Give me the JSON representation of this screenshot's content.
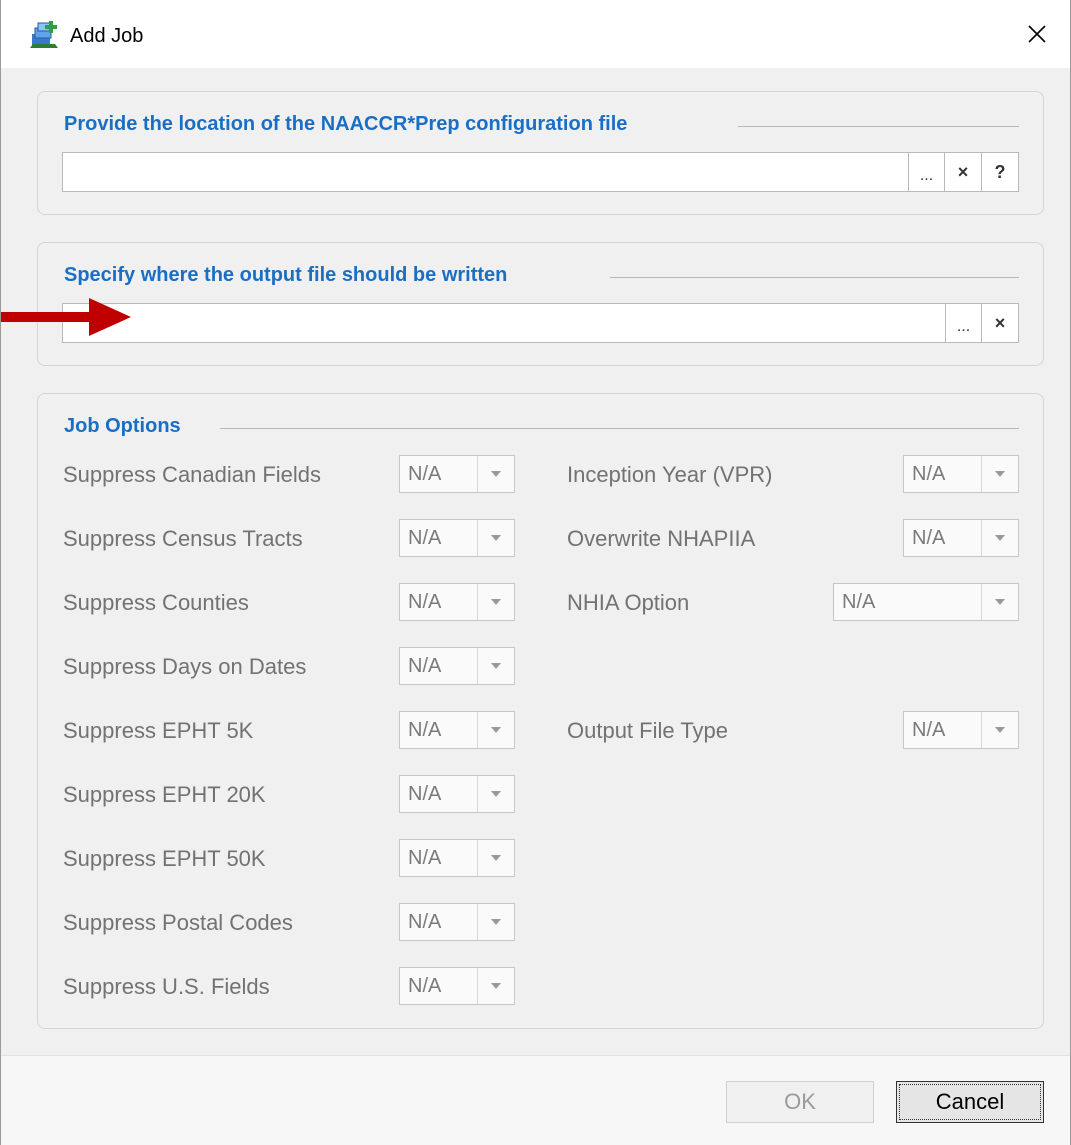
{
  "window": {
    "title": "Add Job"
  },
  "config_group": {
    "title": "Provide the location of the NAACCR*Prep configuration file",
    "path_value": "",
    "browse_label": "...",
    "clear_label": "×",
    "help_label": "?"
  },
  "output_group": {
    "title": "Specify where the output file should be written",
    "path_value": "",
    "browse_label": "...",
    "clear_label": "×"
  },
  "options_group": {
    "title": "Job Options",
    "left": [
      {
        "label": "Suppress Canadian Fields",
        "value": "N/A"
      },
      {
        "label": "Suppress Census Tracts",
        "value": "N/A"
      },
      {
        "label": "Suppress Counties",
        "value": "N/A"
      },
      {
        "label": "Suppress Days on Dates",
        "value": "N/A"
      },
      {
        "label": "Suppress EPHT 5K",
        "value": "N/A"
      },
      {
        "label": "Suppress EPHT 20K",
        "value": "N/A"
      },
      {
        "label": "Suppress EPHT 50K",
        "value": "N/A"
      },
      {
        "label": "Suppress Postal Codes",
        "value": "N/A"
      },
      {
        "label": "Suppress U.S. Fields",
        "value": "N/A"
      }
    ],
    "right": [
      {
        "label": "Inception Year (VPR)",
        "value": "N/A"
      },
      {
        "label": "Overwrite NHAPIIA",
        "value": "N/A"
      },
      {
        "label": "NHIA Option",
        "value": "N/A"
      },
      {
        "label": "Output File Type",
        "value": "N/A"
      }
    ]
  },
  "footer": {
    "ok_label": "OK",
    "cancel_label": "Cancel"
  },
  "colors": {
    "group_title": "#1a6fc4",
    "annotation_arrow": "#c00000"
  }
}
